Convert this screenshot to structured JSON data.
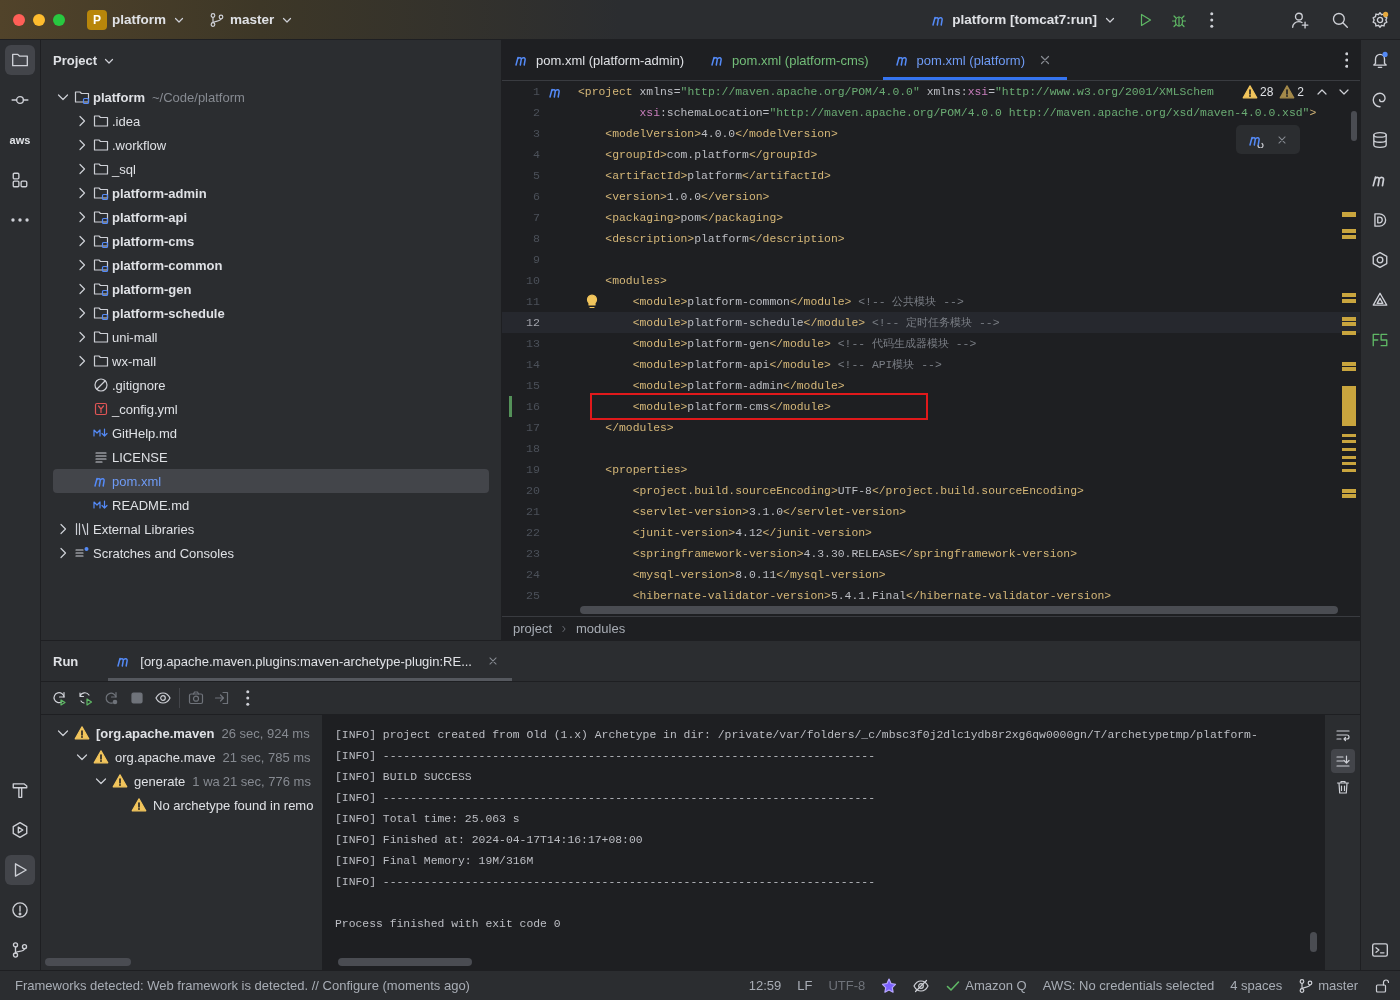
{
  "title_bar": {
    "project_badge": "P",
    "project": "platform",
    "branch": "master",
    "run_configuration": "platform [tomcat7:run]"
  },
  "left_toolbar": {
    "top": [
      {
        "kind": "project",
        "selected": true
      },
      {
        "kind": "commit",
        "selected": false
      },
      {
        "kind": "aws",
        "label": "aws",
        "selected": false
      },
      {
        "kind": "structure",
        "selected": false
      },
      {
        "kind": "more",
        "selected": false
      }
    ],
    "bottom": [
      {
        "kind": "build",
        "selected": false
      },
      {
        "kind": "services",
        "selected": false
      },
      {
        "kind": "run",
        "selected": true
      },
      {
        "kind": "problems",
        "selected": false
      },
      {
        "kind": "git",
        "selected": false
      }
    ]
  },
  "project_panel": {
    "title": "Project",
    "tree": [
      {
        "label": "platform",
        "detail": "~/Code/platform",
        "kind": "module",
        "expanded": true,
        "selected": false,
        "modified": false,
        "children": [
          {
            "label": ".idea",
            "kind": "folder",
            "expanded": false,
            "selected": false,
            "modified": false
          },
          {
            "label": ".workflow",
            "kind": "folder",
            "expanded": false,
            "selected": false,
            "modified": false
          },
          {
            "label": "_sql",
            "kind": "folder",
            "expanded": false,
            "selected": false,
            "modified": false
          },
          {
            "label": "platform-admin",
            "kind": "module",
            "expanded": false,
            "selected": false,
            "modified": false
          },
          {
            "label": "platform-api",
            "kind": "module",
            "expanded": false,
            "selected": false,
            "modified": false
          },
          {
            "label": "platform-cms",
            "kind": "module",
            "expanded": false,
            "selected": false,
            "modified": false
          },
          {
            "label": "platform-common",
            "kind": "module",
            "expanded": false,
            "selected": false,
            "modified": false
          },
          {
            "label": "platform-gen",
            "kind": "module",
            "expanded": false,
            "selected": false,
            "modified": false
          },
          {
            "label": "platform-schedule",
            "kind": "module",
            "expanded": false,
            "selected": false,
            "modified": false
          },
          {
            "label": "uni-mall",
            "kind": "folder",
            "expanded": false,
            "selected": false,
            "modified": false
          },
          {
            "label": "wx-mall",
            "kind": "folder",
            "expanded": false,
            "selected": false,
            "modified": false
          },
          {
            "label": ".gitignore",
            "kind": "ignore",
            "selected": false,
            "modified": false
          },
          {
            "label": "_config.yml",
            "kind": "yaml",
            "selected": false,
            "modified": false
          },
          {
            "label": "GitHelp.md",
            "kind": "markdown",
            "selected": false,
            "modified": false
          },
          {
            "label": "LICENSE",
            "kind": "text",
            "selected": false,
            "modified": false
          },
          {
            "label": "pom.xml",
            "kind": "maven",
            "selected": true,
            "modified": true
          },
          {
            "label": "README.md",
            "kind": "markdown",
            "selected": false,
            "modified": false
          }
        ]
      },
      {
        "label": "External Libraries",
        "kind": "libraries",
        "expanded": false,
        "selected": false,
        "modified": false
      },
      {
        "label": "Scratches and Consoles",
        "kind": "scratches",
        "expanded": false,
        "selected": false,
        "modified": false
      }
    ]
  },
  "editor": {
    "tabs": [
      {
        "label": "pom.xml (platform-admin)",
        "color": "#dfe1e5",
        "selected": false
      },
      {
        "label": "pom.xml (platform-cms)",
        "color": "#73bd79",
        "selected": false
      },
      {
        "label": "pom.xml (platform)",
        "color": "#6f9bf5",
        "selected": true
      }
    ],
    "inspections": {
      "warnings": "28",
      "weak_warnings": "2"
    },
    "lines": [
      {
        "n": "1",
        "current": false,
        "changed": false,
        "boxed": false,
        "kind": "maven",
        "tokens": [
          {
            "kind": "tag",
            "text": "<project"
          },
          {
            "kind": "attr",
            "text": " xmlns="
          },
          {
            "kind": "string",
            "text": "\"http://maven.apache.org/POM/4.0.0\""
          },
          {
            "kind": "attr",
            "text": " xmlns:"
          },
          {
            "kind": "ns",
            "text": "xsi"
          },
          {
            "kind": "attr",
            "text": "="
          },
          {
            "kind": "string",
            "text": "\"http://www.w3.org/2001/XMLSchem"
          }
        ]
      },
      {
        "n": "2",
        "kind": "plain",
        "current": false,
        "changed": false,
        "boxed": false,
        "tokens": [
          {
            "kind": "ns",
            "text": "         xsi"
          },
          {
            "kind": "attr",
            "text": ":schemaLocation="
          },
          {
            "kind": "string",
            "text": "\"http://maven.apache.org/POM/4.0.0 http://maven.apache.org/xsd/maven-4.0.0.xsd\""
          },
          {
            "kind": "tag",
            "text": ">"
          }
        ]
      },
      {
        "n": "3",
        "kind": "plain",
        "current": false,
        "changed": false,
        "boxed": false,
        "tokens": [
          {
            "kind": "tag",
            "text": "    <modelVersion>"
          },
          {
            "kind": "text",
            "text": "4.0.0"
          },
          {
            "kind": "tag",
            "text": "</modelVersion>"
          }
        ]
      },
      {
        "n": "4",
        "kind": "plain",
        "current": false,
        "changed": false,
        "boxed": false,
        "tokens": [
          {
            "kind": "tag",
            "text": "    <groupId>"
          },
          {
            "kind": "text",
            "text": "com.platform"
          },
          {
            "kind": "tag",
            "text": "</groupId>"
          }
        ]
      },
      {
        "n": "5",
        "kind": "plain",
        "current": false,
        "changed": false,
        "boxed": false,
        "tokens": [
          {
            "kind": "tag",
            "text": "    <artifactId>"
          },
          {
            "kind": "text",
            "text": "platform"
          },
          {
            "kind": "tag",
            "text": "</artifactId>"
          }
        ]
      },
      {
        "n": "6",
        "kind": "plain",
        "current": false,
        "changed": false,
        "boxed": false,
        "tokens": [
          {
            "kind": "tag",
            "text": "    <version>"
          },
          {
            "kind": "text",
            "text": "1.0.0"
          },
          {
            "kind": "tag",
            "text": "</version>"
          }
        ]
      },
      {
        "n": "7",
        "kind": "plain",
        "current": false,
        "changed": false,
        "boxed": false,
        "tokens": [
          {
            "kind": "tag",
            "text": "    <packaging>"
          },
          {
            "kind": "text",
            "text": "pom"
          },
          {
            "kind": "tag",
            "text": "</packaging>"
          }
        ]
      },
      {
        "n": "8",
        "kind": "plain",
        "current": false,
        "changed": false,
        "boxed": false,
        "tokens": [
          {
            "kind": "tag",
            "text": "    <description>"
          },
          {
            "kind": "text",
            "text": "platform"
          },
          {
            "kind": "tag",
            "text": "</description>"
          }
        ]
      },
      {
        "n": "9",
        "kind": "plain",
        "current": false,
        "changed": false,
        "boxed": false
      },
      {
        "n": "10",
        "kind": "plain",
        "current": false,
        "changed": false,
        "boxed": false,
        "tokens": [
          {
            "kind": "tag",
            "text": "    <modules>"
          }
        ]
      },
      {
        "n": "11",
        "current": false,
        "changed": false,
        "boxed": false,
        "kind": "bulb",
        "tokens": [
          {
            "kind": "tag",
            "text": "        <module>"
          },
          {
            "kind": "text",
            "text": "platform-common"
          },
          {
            "kind": "tag",
            "text": "</module>"
          },
          {
            "kind": "comment",
            "text": " <!-- 公共模块 -->"
          }
        ]
      },
      {
        "n": "12",
        "kind": "plain",
        "current": true,
        "changed": false,
        "boxed": false,
        "tokens": [
          {
            "kind": "tag",
            "text": "        <module>"
          },
          {
            "kind": "text",
            "text": "platform-schedule"
          },
          {
            "kind": "tag",
            "text": "</module>"
          },
          {
            "kind": "comment",
            "text": " <!-- 定时任务模块 -->"
          }
        ]
      },
      {
        "n": "13",
        "kind": "plain",
        "current": false,
        "changed": false,
        "boxed": false,
        "tokens": [
          {
            "kind": "tag",
            "text": "        <module>"
          },
          {
            "kind": "text",
            "text": "platform-gen"
          },
          {
            "kind": "tag",
            "text": "</module>"
          },
          {
            "kind": "comment",
            "text": " <!-- 代码生成器模块 -->"
          }
        ]
      },
      {
        "n": "14",
        "kind": "plain",
        "current": false,
        "changed": false,
        "boxed": false,
        "tokens": [
          {
            "kind": "tag",
            "text": "        <module>"
          },
          {
            "kind": "text",
            "text": "platform-api"
          },
          {
            "kind": "tag",
            "text": "</module>"
          },
          {
            "kind": "comment",
            "text": " <!-- API模块 -->"
          }
        ]
      },
      {
        "n": "15",
        "kind": "plain",
        "current": false,
        "changed": false,
        "boxed": false,
        "tokens": [
          {
            "kind": "tag",
            "text": "        <module>"
          },
          {
            "kind": "text",
            "text": "platform-admin"
          },
          {
            "kind": "tag",
            "text": "</module>"
          }
        ]
      },
      {
        "n": "16",
        "kind": "plain",
        "current": false,
        "changed": true,
        "boxed": true,
        "tokens": [
          {
            "kind": "tag",
            "text": "        <module>"
          },
          {
            "kind": "text",
            "text": "platform-cms"
          },
          {
            "kind": "tag",
            "text": "</module>"
          }
        ]
      },
      {
        "n": "17",
        "kind": "plain",
        "current": false,
        "changed": false,
        "boxed": false,
        "tokens": [
          {
            "kind": "tag",
            "text": "    </modules>"
          }
        ]
      },
      {
        "n": "18",
        "kind": "plain",
        "current": false,
        "changed": false,
        "boxed": false
      },
      {
        "n": "19",
        "kind": "plain",
        "current": false,
        "changed": false,
        "boxed": false,
        "tokens": [
          {
            "kind": "tag",
            "text": "    <properties>"
          }
        ]
      },
      {
        "n": "20",
        "kind": "plain",
        "current": false,
        "changed": false,
        "boxed": false,
        "tokens": [
          {
            "kind": "tag",
            "text": "        <project.build.sourceEncoding>"
          },
          {
            "kind": "text",
            "text": "UTF-8"
          },
          {
            "kind": "tag",
            "text": "</project.build.sourceEncoding>"
          }
        ]
      },
      {
        "n": "21",
        "kind": "plain",
        "current": false,
        "changed": false,
        "boxed": false,
        "tokens": [
          {
            "kind": "tag",
            "text": "        <servlet-version>"
          },
          {
            "kind": "text",
            "text": "3.1.0"
          },
          {
            "kind": "tag",
            "text": "</servlet-version>"
          }
        ]
      },
      {
        "n": "22",
        "kind": "plain",
        "current": false,
        "changed": false,
        "boxed": false,
        "tokens": [
          {
            "kind": "tag",
            "text": "        <junit-version>"
          },
          {
            "kind": "text",
            "text": "4.12"
          },
          {
            "kind": "tag",
            "text": "</junit-version>"
          }
        ]
      },
      {
        "n": "23",
        "kind": "plain",
        "current": false,
        "changed": false,
        "boxed": false,
        "tokens": [
          {
            "kind": "tag",
            "text": "        <springframework-version>"
          },
          {
            "kind": "text",
            "text": "4.3.30.RELEASE"
          },
          {
            "kind": "tag",
            "text": "</springframework-version>"
          }
        ]
      },
      {
        "n": "24",
        "kind": "plain",
        "current": false,
        "changed": false,
        "boxed": false,
        "tokens": [
          {
            "kind": "tag",
            "text": "        <mysql-version>"
          },
          {
            "kind": "text",
            "text": "8.0.11"
          },
          {
            "kind": "tag",
            "text": "</mysql-version>"
          }
        ]
      },
      {
        "n": "25",
        "kind": "plain",
        "current": false,
        "changed": false,
        "boxed": false,
        "tokens": [
          {
            "kind": "tag",
            "text": "        <hibernate-validator-version>"
          },
          {
            "kind": "text",
            "text": "5.4.1.Final"
          },
          {
            "kind": "tag",
            "text": "</hibernate-validator-version>"
          }
        ]
      }
    ],
    "breadcrumbs": [
      "project",
      "modules"
    ]
  },
  "right_toolbar": {
    "top": [
      {
        "kind": "notifications"
      },
      {
        "kind": "ai"
      },
      {
        "kind": "database"
      },
      {
        "kind": "maven"
      },
      {
        "kind": "d"
      },
      {
        "kind": "hexagon"
      },
      {
        "kind": "triangle"
      },
      {
        "kind": "plugin"
      }
    ],
    "bottom": [
      {
        "kind": "terminal"
      }
    ]
  },
  "run_panel": {
    "title": "Run",
    "tabs": [
      {
        "label": "[org.apache.maven.plugins:maven-archetype-plugin:RE...",
        "selected": true
      }
    ],
    "toolbar": [
      {
        "kind": "rerun",
        "disabled": false
      },
      {
        "kind": "rerun-failed",
        "disabled": false
      },
      {
        "kind": "rerun-auto",
        "disabled": true
      },
      {
        "kind": "stop",
        "disabled": true
      },
      {
        "kind": "watch",
        "disabled": false
      },
      {
        "kind": "screenshot",
        "disabled": true
      },
      {
        "kind": "export",
        "disabled": true
      },
      {
        "kind": "more",
        "disabled": false
      }
    ],
    "tree": [
      {
        "label": "[org.apache.maven",
        "time": "26 sec, 924 ms",
        "expanded": true,
        "children": [
          {
            "label": "org.apache.mave",
            "time": "21 sec, 785 ms",
            "expanded": true,
            "children": [
              {
                "label": "generate",
                "note": "1 wa",
                "time": "21 sec, 776 ms",
                "expanded": true,
                "children": [
                  {
                    "label": "No archetype found in remo"
                  }
                ]
              }
            ]
          }
        ]
      }
    ],
    "console": [
      {
        "kind": "output",
        "text": "[INFO] project created from Old (1.x) Archetype in dir: /private/var/folders/_c/mbsc3f0j2dlc1ydb8r2xg6qw0000gn/T/archetypetmp/platform-"
      },
      {
        "kind": "output",
        "text": "[INFO] ------------------------------------------------------------------------"
      },
      {
        "kind": "output",
        "text": "[INFO] BUILD SUCCESS"
      },
      {
        "kind": "output",
        "text": "[INFO] ------------------------------------------------------------------------"
      },
      {
        "kind": "output",
        "text": "[INFO] Total time: 25.063 s"
      },
      {
        "kind": "output",
        "text": "[INFO] Finished at: 2024-04-17T14:16:17+08:00"
      },
      {
        "kind": "output",
        "text": "[INFO] Final Memory: 19M/316M"
      },
      {
        "kind": "output",
        "text": "[INFO] ------------------------------------------------------------------------"
      },
      {
        "kind": "exit",
        "text": "Process finished with exit code 0"
      }
    ]
  },
  "status_bar": {
    "message": "Frameworks detected: Web framework is detected. // Configure (moments ago)",
    "position": "12:59",
    "line_separator": "LF",
    "encoding": "UTF-8",
    "amazon_q": "Amazon Q",
    "aws": "AWS: No credentials selected",
    "indent": "4 spaces",
    "branch": "master"
  }
}
